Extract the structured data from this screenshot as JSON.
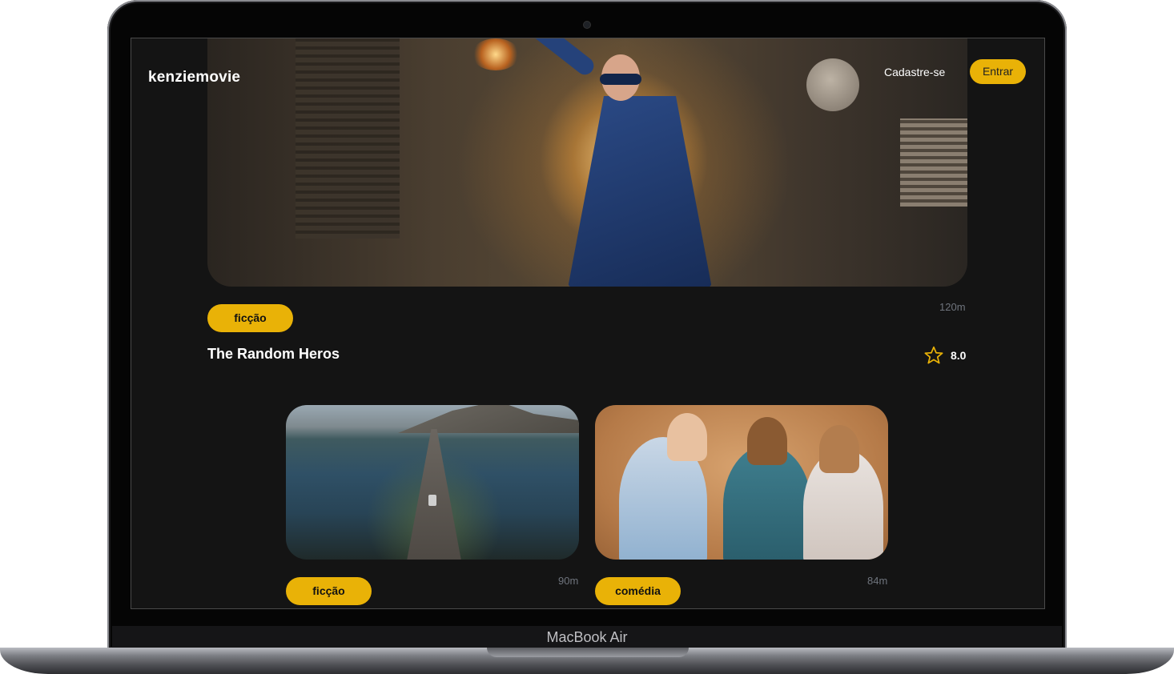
{
  "device": {
    "label": "MacBook Air"
  },
  "header": {
    "brand": "kenziemovie",
    "signup_label": "Cadastre-se",
    "login_label": "Entrar"
  },
  "featured": {
    "genre": "ficção",
    "duration": "120m",
    "title": "The Random Heros",
    "rating": "8.0",
    "rating_icon": "star-outline-icon"
  },
  "movies": [
    {
      "genre": "ficção",
      "duration": "90m"
    },
    {
      "genre": "comédia",
      "duration": "84m"
    }
  ],
  "colors": {
    "accent": "#e9b207",
    "background": "#141414",
    "muted_text": "#6f747d"
  }
}
